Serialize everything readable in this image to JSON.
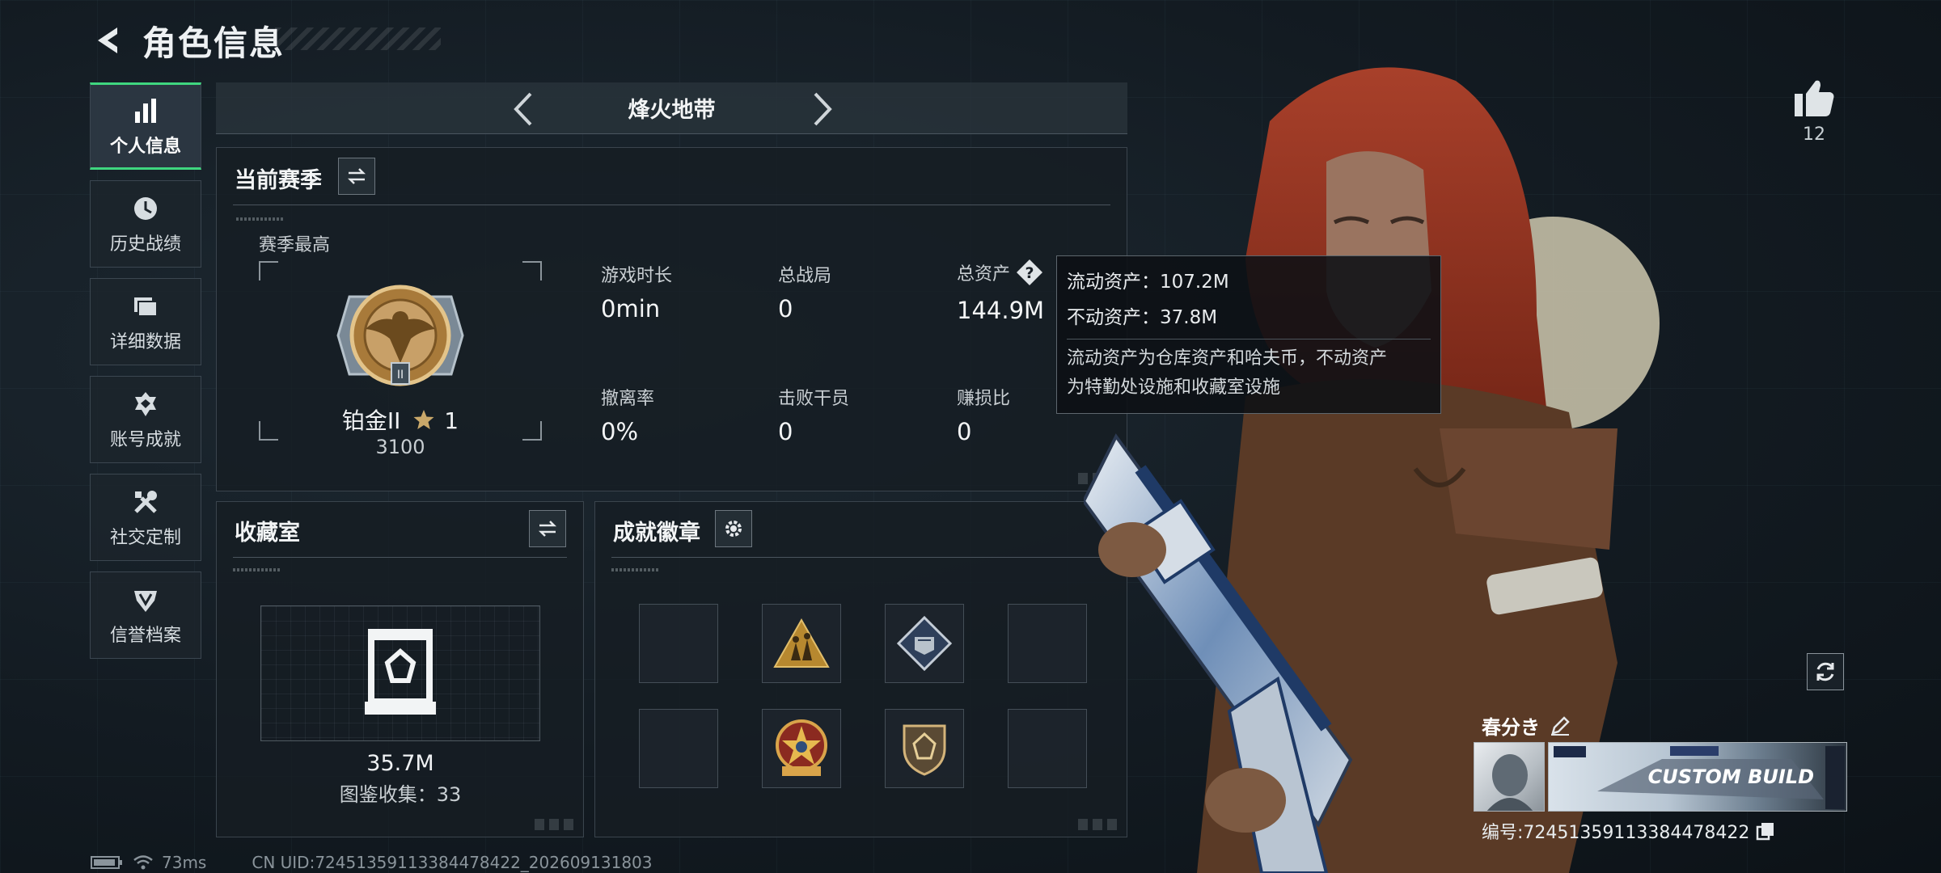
{
  "header": {
    "title": "角色信息"
  },
  "sidebar": {
    "items": [
      {
        "label": "个人信息",
        "icon": "bar-chart-icon",
        "active": true
      },
      {
        "label": "历史战绩",
        "icon": "history-icon",
        "active": false
      },
      {
        "label": "详细数据",
        "icon": "folder-icon",
        "active": false
      },
      {
        "label": "账号成就",
        "icon": "achievement-icon",
        "active": false
      },
      {
        "label": "社交定制",
        "icon": "tools-icon",
        "active": false
      },
      {
        "label": "信誉档案",
        "icon": "reputation-icon",
        "active": false
      }
    ]
  },
  "mode": {
    "title": "烽火地带"
  },
  "season": {
    "title": "当前赛季",
    "subtitle": "赛季最高",
    "rank_name": "铂金II",
    "rank_stars": "1",
    "rank_points": "3100",
    "stats": [
      {
        "label": "游戏时长",
        "value": "0min"
      },
      {
        "label": "总战局",
        "value": "0"
      },
      {
        "label": "总资产",
        "value": "144.9M"
      },
      {
        "label": "撤离率",
        "value": "0%"
      },
      {
        "label": "击败干员",
        "value": "0"
      },
      {
        "label": "赚损比",
        "value": "0"
      }
    ]
  },
  "tooltip": {
    "liquid": "流动资产：107.2M",
    "fixed": "不动资产：37.8M",
    "desc_line1": "流动资产为仓库资产和哈夫币，不动资产",
    "desc_line2": "为特勤处设施和收藏室设施"
  },
  "collection": {
    "title": "收藏室",
    "value": "35.7M",
    "count_text": "图鉴收集：33"
  },
  "badges": {
    "title": "成就徽章",
    "slots": [
      "",
      "triangle-soldiers-badge",
      "diamond-crest-badge",
      "",
      "",
      "star-seal-badge",
      "shield-gem-badge",
      ""
    ]
  },
  "profile": {
    "likes": "12",
    "player_name": "春分き",
    "player_id": "编号:72451359113384478422",
    "banner_text": "CUSTOM BUILD"
  },
  "status": {
    "ping": "73ms",
    "uid": "CN UID:72451359113384478422_202609131803"
  },
  "colors": {
    "accent_green": "#3fd67f",
    "panel_bg": "#161d23",
    "hair": "#8a2a1c"
  }
}
